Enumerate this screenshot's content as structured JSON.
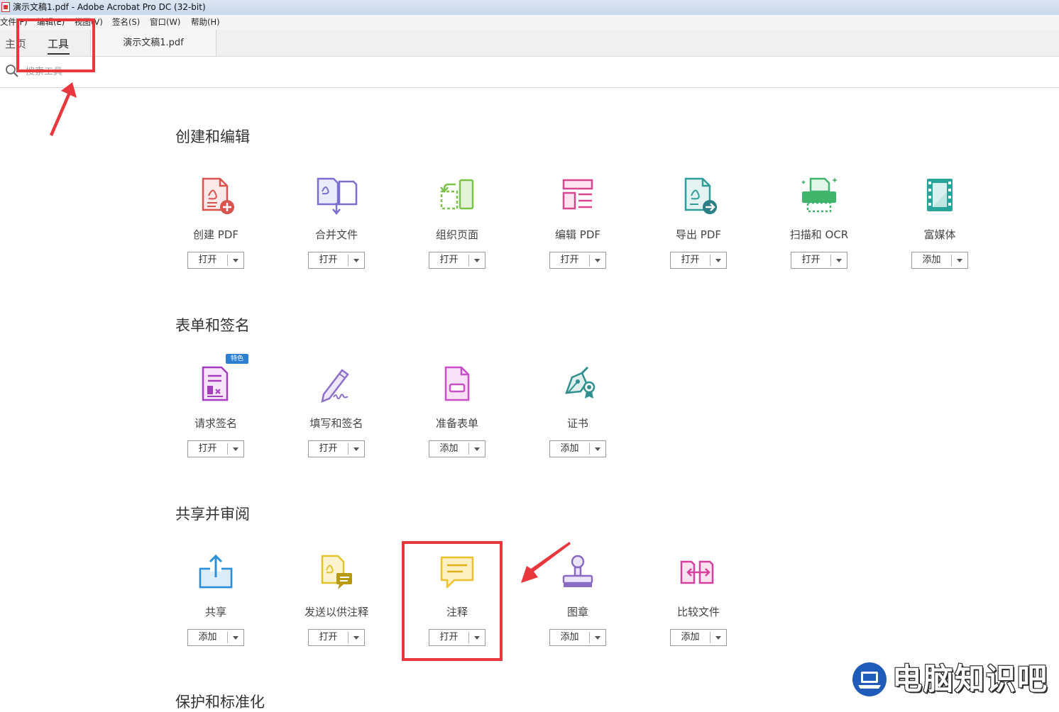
{
  "window": {
    "title": "演示文稿1.pdf - Adobe Acrobat Pro DC (32-bit)"
  },
  "menubar": {
    "items": [
      "文件(F)",
      "编辑(E)",
      "视图(V)",
      "签名(S)",
      "窗口(W)",
      "帮助(H)"
    ]
  },
  "tabs": {
    "home": "主页",
    "tools": "工具",
    "document": "演示文稿1.pdf"
  },
  "search": {
    "placeholder": "搜索工具"
  },
  "sections": [
    {
      "title": "创建和编辑",
      "tools": [
        {
          "label": "创建 PDF",
          "button": "打开",
          "icon": "create-pdf-icon"
        },
        {
          "label": "合并文件",
          "button": "打开",
          "icon": "combine-files-icon"
        },
        {
          "label": "组织页面",
          "button": "打开",
          "icon": "organize-pages-icon"
        },
        {
          "label": "编辑 PDF",
          "button": "打开",
          "icon": "edit-pdf-icon"
        },
        {
          "label": "导出 PDF",
          "button": "打开",
          "icon": "export-pdf-icon"
        },
        {
          "label": "扫描和 OCR",
          "button": "打开",
          "icon": "scan-ocr-icon"
        },
        {
          "label": "富媒体",
          "button": "添加",
          "icon": "rich-media-icon"
        }
      ]
    },
    {
      "title": "表单和签名",
      "badge": "特色",
      "tools": [
        {
          "label": "请求签名",
          "button": "打开",
          "icon": "request-signature-icon"
        },
        {
          "label": "填写和签名",
          "button": "打开",
          "icon": "fill-sign-icon"
        },
        {
          "label": "准备表单",
          "button": "添加",
          "icon": "prepare-form-icon"
        },
        {
          "label": "证书",
          "button": "添加",
          "icon": "certificate-icon"
        }
      ]
    },
    {
      "title": "共享并审阅",
      "tools": [
        {
          "label": "共享",
          "button": "添加",
          "icon": "share-icon"
        },
        {
          "label": "发送以供注释",
          "button": "打开",
          "icon": "send-for-comment-icon"
        },
        {
          "label": "注释",
          "button": "打开",
          "icon": "comment-icon"
        },
        {
          "label": "图章",
          "button": "添加",
          "icon": "stamp-icon"
        },
        {
          "label": "比较文件",
          "button": "添加",
          "icon": "compare-files-icon"
        }
      ]
    }
  ],
  "partial_section_title": "保护和标准化",
  "watermark": {
    "text": "电脑知识吧"
  },
  "colors": {
    "annotation_red": "#e8383d",
    "create_red": "#d9534f",
    "combine_purple": "#7b6fd1",
    "organize_green": "#7cc24a",
    "edit_pink": "#d9468f",
    "export_teal": "#2f9e9a",
    "scan_green": "#3fb46a",
    "media_teal": "#2aa39a",
    "signature_purple": "#a63dbf",
    "fill_purple": "#8e6fc9",
    "form_pink": "#c94fc8",
    "cert_teal": "#2e8f8f",
    "share_blue": "#2d8fd8",
    "send_yellow": "#e3c32b",
    "comment_yellow": "#f0c22b",
    "stamp_purple": "#8a6ac2",
    "compare_pink": "#d6409f"
  }
}
